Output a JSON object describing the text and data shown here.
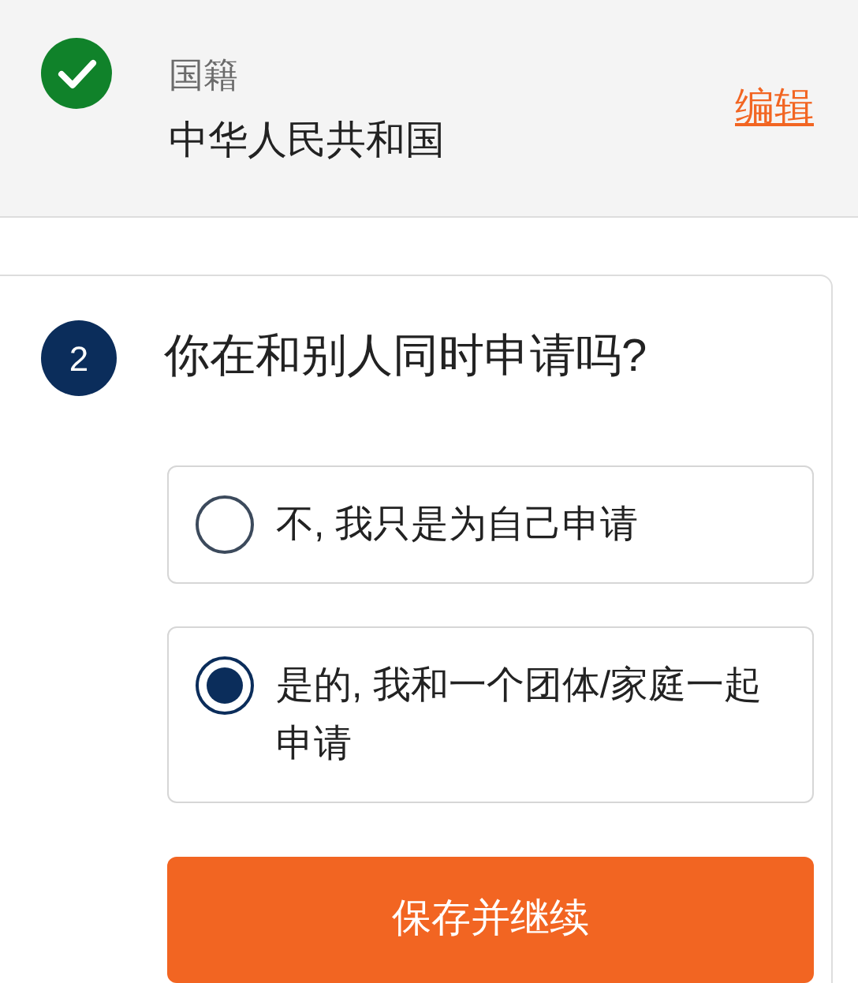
{
  "summary": {
    "done": true,
    "label": "国籍",
    "value": "中华人民共和国",
    "edit_link": "编辑"
  },
  "question": {
    "number": "2",
    "text": "你在和别人同时申请吗?",
    "options": [
      {
        "label": "不, 我只是为自己申请",
        "selected": false
      },
      {
        "label": "是的, 我和一个团体/家庭一起申请",
        "selected": true
      }
    ],
    "submit": "保存并继续"
  }
}
